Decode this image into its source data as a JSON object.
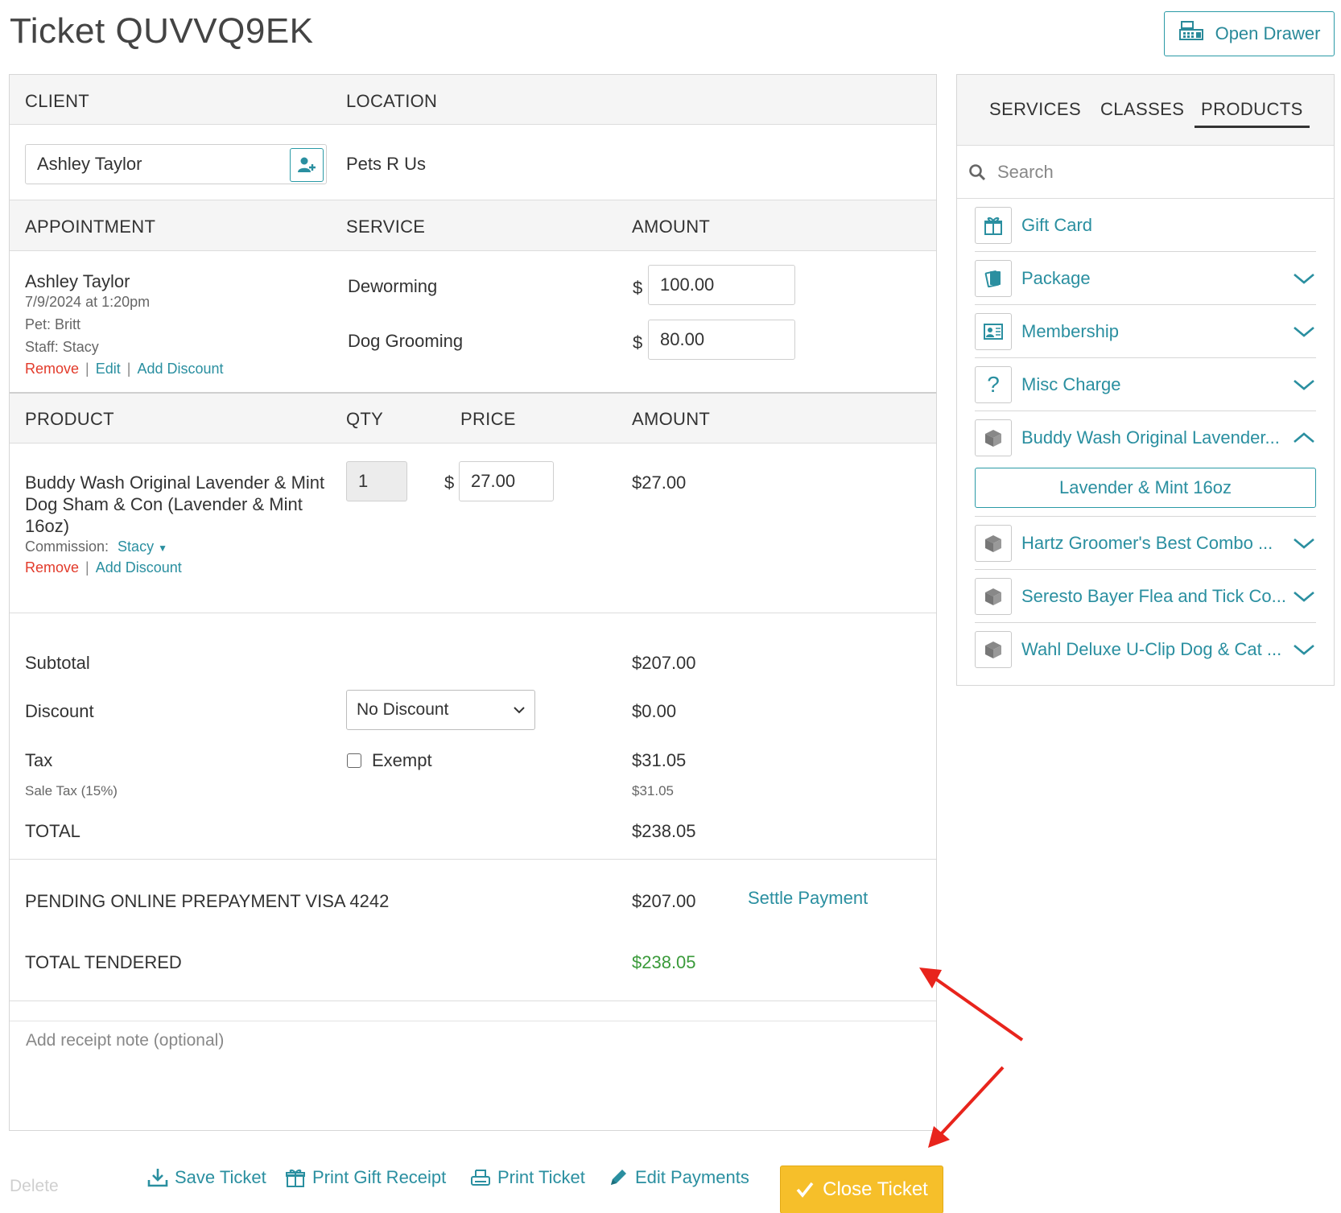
{
  "title": "Ticket QUVVQ9EK",
  "open_drawer": "Open Drawer",
  "client_section": {
    "client_header": "CLIENT",
    "location_header": "LOCATION",
    "client_value": "Ashley Taylor",
    "location_value": "Pets R Us"
  },
  "appointment_section": {
    "headers": {
      "appointment": "APPOINTMENT",
      "service": "SERVICE",
      "amount": "AMOUNT"
    },
    "client_name": "Ashley Taylor",
    "datetime": "7/9/2024 at 1:20pm",
    "pet": "Pet: Britt",
    "staff": "Staff: Stacy",
    "remove": "Remove",
    "edit": "Edit",
    "add_discount": "Add Discount",
    "currency": "$",
    "services": [
      {
        "name": "Deworming",
        "amount": "100.00"
      },
      {
        "name": "Dog Grooming",
        "amount": "80.00"
      }
    ]
  },
  "product_section": {
    "headers": {
      "product": "PRODUCT",
      "qty": "QTY",
      "price": "PRICE",
      "amount": "AMOUNT"
    },
    "name_line1": "Buddy Wash Original Lavender & Mint",
    "name_line2": "Dog Sham & Con (Lavender & Mint",
    "name_line3": "16oz)",
    "qty": "1",
    "currency": "$",
    "price": "27.00",
    "amount": "$27.00",
    "commission_label": "Commission:",
    "commission_value": "Stacy",
    "remove": "Remove",
    "add_discount": "Add Discount"
  },
  "totals": {
    "subtotal_label": "Subtotal",
    "subtotal_value": "$207.00",
    "discount_label": "Discount",
    "discount_select": "No Discount",
    "discount_value": "$0.00",
    "tax_label": "Tax",
    "exempt_label": "Exempt",
    "tax_value": "$31.05",
    "sale_tax_label": "Sale Tax (15%)",
    "sale_tax_value": "$31.05",
    "total_label": "TOTAL",
    "total_value": "$238.05"
  },
  "payments": {
    "pending_label": "PENDING ONLINE PREPAYMENT VISA 4242",
    "pending_value": "$207.00",
    "settle_link": "Settle Payment",
    "tendered_label": "TOTAL TENDERED",
    "tendered_value": "$238.05",
    "tendered_color": "#3a9a3a"
  },
  "receipt_note_placeholder": "Add receipt note (optional)",
  "actions": {
    "delete": "Delete",
    "save_ticket": "Save Ticket",
    "print_gift_receipt": "Print Gift Receipt",
    "print_ticket": "Print Ticket",
    "edit_payments": "Edit Payments",
    "close_ticket": "Close Ticket"
  },
  "sidebar": {
    "tabs": [
      "SERVICES",
      "CLASSES",
      "PRODUCTS"
    ],
    "active_tab": "PRODUCTS",
    "search_placeholder": "Search",
    "items": [
      {
        "label": "Gift Card",
        "icon": "gift-icon"
      },
      {
        "label": "Package",
        "icon": "package-icon"
      },
      {
        "label": "Membership",
        "icon": "membership-icon"
      },
      {
        "label": "Misc Charge",
        "icon": "question-icon"
      },
      {
        "label": "Buddy Wash Original Lavender...",
        "icon": "box-icon",
        "expanded": true
      },
      {
        "label": "Hartz Groomer's Best Combo ...",
        "icon": "box-icon"
      },
      {
        "label": "Seresto Bayer Flea and Tick Co...",
        "icon": "box-icon"
      },
      {
        "label": "Wahl Deluxe U-Clip Dog & Cat ...",
        "icon": "box-icon"
      }
    ],
    "variant": "Lavender & Mint 16oz"
  },
  "colors": {
    "accent": "#2a8fa0",
    "remove": "#e23a2a",
    "close_button": "#f6bf2a",
    "annotation_arrow": "#e8241c"
  }
}
